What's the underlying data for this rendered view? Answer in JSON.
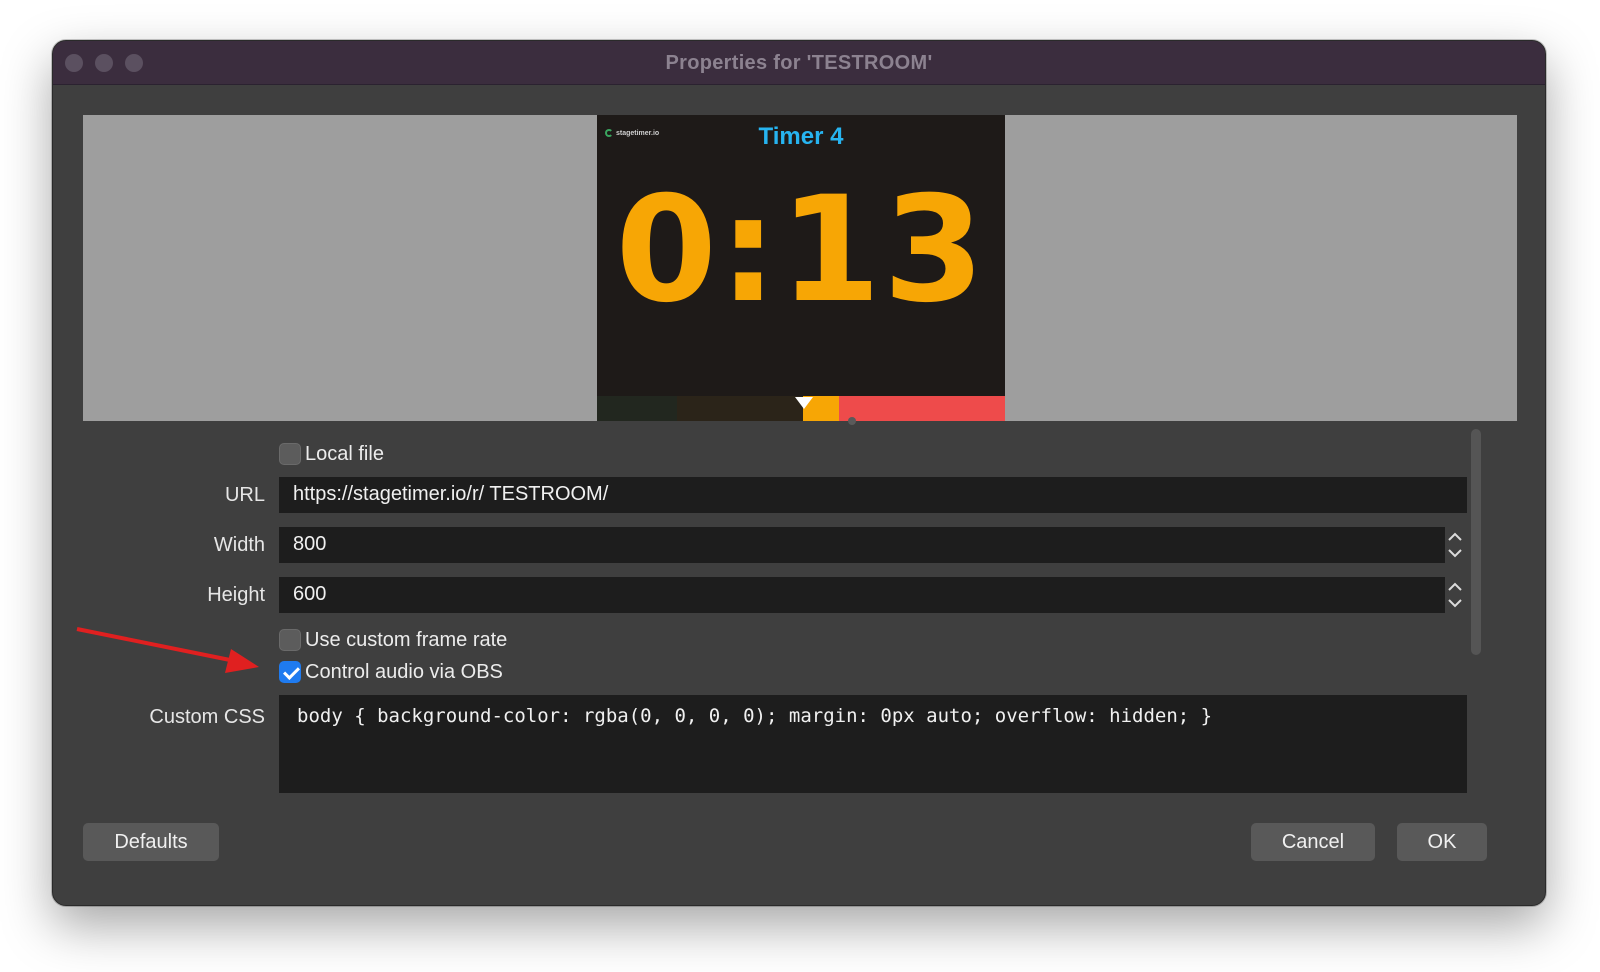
{
  "window": {
    "title": "Properties for 'TESTROOM'"
  },
  "preview": {
    "logo_text": "stagetimer.io",
    "timer_name": "Timer 4",
    "timer_value": "0:13",
    "progress_fraction": 0.59
  },
  "form": {
    "local_file": {
      "label": "Local file",
      "checked": false
    },
    "url": {
      "label": "URL",
      "value": "https://stagetimer.io/r/ TESTROOM/"
    },
    "width": {
      "label": "Width",
      "value": "800"
    },
    "height": {
      "label": "Height",
      "value": "600"
    },
    "custom_frame_rate": {
      "label": "Use custom frame rate",
      "checked": false
    },
    "control_audio": {
      "label": "Control audio via OBS",
      "checked": true
    },
    "custom_css": {
      "label": "Custom CSS",
      "value": "body { background-color: rgba(0, 0, 0, 0); margin: 0px auto; overflow: hidden; }"
    }
  },
  "buttons": {
    "defaults": "Defaults",
    "cancel": "Cancel",
    "ok": "OK"
  },
  "colors": {
    "timer_digits": "#f7a605",
    "timer_title": "#27b4f0",
    "checkbox_checked": "#1f7bf0",
    "annotation_arrow": "#e02020"
  }
}
